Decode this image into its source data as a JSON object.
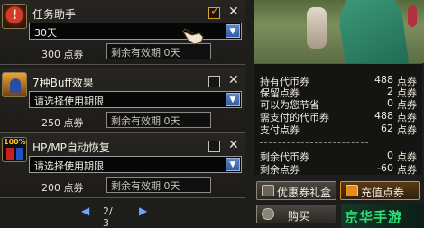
{
  "items": [
    {
      "title": "任务助手",
      "checked": true,
      "duration": "30天",
      "price": "300 点券",
      "expiry": "剩余有效期 0天",
      "icon": "task-scroll-icon"
    },
    {
      "title": "7种Buff效果",
      "checked": false,
      "duration": "请选择使用期限",
      "price": "250 点券",
      "expiry": "剩余有效期 0天",
      "icon": "buff-character-icon"
    },
    {
      "title": "HP/MP自动恢复",
      "checked": false,
      "duration": "请选择使用期限",
      "price": "200 点券",
      "expiry": "剩余有效期 0天",
      "icon": "hp-mp-potion-icon",
      "icon_badge": "100%"
    }
  ],
  "pager": {
    "text": "2/ 3"
  },
  "summary": {
    "rows": [
      {
        "label": "持有代币券",
        "value": "488",
        "unit": "点券"
      },
      {
        "label": "保留点券",
        "value": "2",
        "unit": "点券"
      },
      {
        "label": "可以为您节省",
        "value": "0",
        "unit": "点券"
      },
      {
        "label": "需支付的代币券",
        "value": "488",
        "unit": "点券"
      },
      {
        "label": "支付点券",
        "value": "62",
        "unit": "点券"
      },
      {
        "label": "剩余代币券",
        "value": "0",
        "unit": "点券"
      },
      {
        "label": "剩余点券",
        "value": "-60",
        "unit": "点券"
      }
    ]
  },
  "buttons": {
    "coupon": "优惠券礼盒",
    "recharge": "充值点券",
    "buy": "购买"
  },
  "watermark": "京华手游",
  "colors": {
    "accent_orange": "#e08b1a",
    "dropdown_blue": "#2f5da8",
    "watermark_green": "#2fe07a"
  }
}
